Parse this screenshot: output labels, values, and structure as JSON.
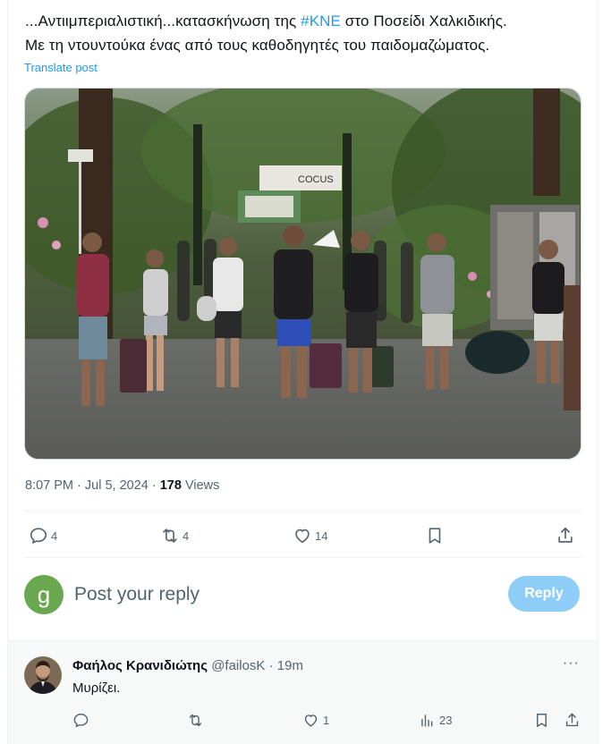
{
  "post": {
    "text_line1_prefix": "...Αντιιμπεριαλιστική...κατασκήνωση της ",
    "hashtag": "#KNE",
    "text_line1_suffix": " στο Ποσείδι Χαλκιδικής.",
    "text_line2": "Με τη ντουντούκα ένας από τους καθοδηγητές του παιδομαζώματος.",
    "translate_label": "Translate post",
    "photo_sign_text": "COCUS",
    "timestamp": "8:07 PM · Jul 5, 2024",
    "separator": " · ",
    "views_count": "178",
    "views_label": " Views",
    "actions": {
      "replies": "4",
      "reposts": "4",
      "likes": "14"
    }
  },
  "reply_box": {
    "avatar_letter": "g",
    "placeholder": "Post your reply",
    "button_label": "Reply"
  },
  "comment": {
    "name": "Φαήλος Κρανιδιώτης",
    "handle": "@failosK",
    "dot": " · ",
    "time": "19m",
    "more": "···",
    "text": "Μυρίζει.",
    "likes": "1",
    "views": "23"
  },
  "colors": {
    "accent": "#1d9bf0",
    "reply_button": "#8ecdf8",
    "muted": "#536471",
    "avatar_bg": "#6aa84f"
  }
}
